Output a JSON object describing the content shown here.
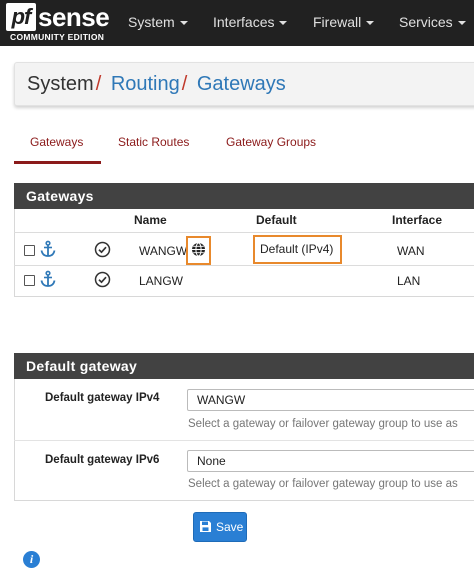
{
  "brand": {
    "logo_pf": "pf",
    "logo_sense": "sense",
    "logo_sub": "COMMUNITY EDITION"
  },
  "nav": {
    "items": [
      {
        "label": "System"
      },
      {
        "label": "Interfaces"
      },
      {
        "label": "Firewall"
      },
      {
        "label": "Services"
      }
    ]
  },
  "breadcrumb": {
    "root": "System",
    "sep": "/",
    "items": [
      "Routing",
      "Gateways"
    ]
  },
  "tabs": [
    {
      "label": "Gateways",
      "active": true
    },
    {
      "label": "Static Routes",
      "active": false
    },
    {
      "label": "Gateway Groups",
      "active": false
    }
  ],
  "gateways_panel": {
    "title": "Gateways",
    "columns": [
      "Name",
      "Default",
      "Interface"
    ],
    "rows": [
      {
        "name": "WANGW",
        "default": "Default (IPv4)",
        "interface": "WAN"
      },
      {
        "name": "LANGW",
        "default": "",
        "interface": "LAN"
      }
    ]
  },
  "default_gateway_panel": {
    "title": "Default gateway",
    "ipv4": {
      "label": "Default gateway IPv4",
      "value": "WANGW",
      "help": "Select a gateway or failover gateway group to use as"
    },
    "ipv6": {
      "label": "Default gateway IPv6",
      "value": "None",
      "help": "Select a gateway or failover gateway group to use as"
    }
  },
  "save_label": "Save",
  "info_glyph": "i",
  "colors": {
    "navbar": "#212121",
    "panel_header": "#424242",
    "tab_active": "#8b1a1a",
    "link": "#2f78b7",
    "highlight": "#e8892c",
    "button": "#2a7fd4"
  }
}
